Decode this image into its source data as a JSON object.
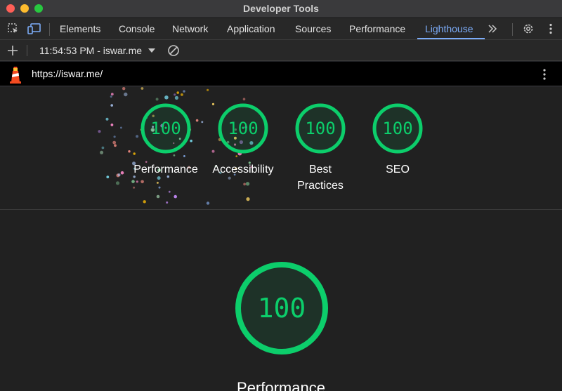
{
  "window": {
    "title": "Developer Tools"
  },
  "tabs": [
    {
      "label": "Elements"
    },
    {
      "label": "Console"
    },
    {
      "label": "Network"
    },
    {
      "label": "Application"
    },
    {
      "label": "Sources"
    },
    {
      "label": "Performance"
    },
    {
      "label": "Lighthouse",
      "active": true
    }
  ],
  "toolbar": {
    "report_selector": "11:54:53 PM - iswar.me"
  },
  "urlbar": {
    "url": "https://iswar.me/"
  },
  "scores": [
    {
      "name": "Performance",
      "score": "100"
    },
    {
      "name": "Accessibility",
      "score": "100"
    },
    {
      "name": "Best Practices",
      "score": "100"
    },
    {
      "name": "SEO",
      "score": "100"
    }
  ],
  "main_gauge": {
    "score": "100",
    "label": "Performance"
  },
  "colors": {
    "pass": "#0cce6b",
    "accent": "#7cacf8"
  }
}
